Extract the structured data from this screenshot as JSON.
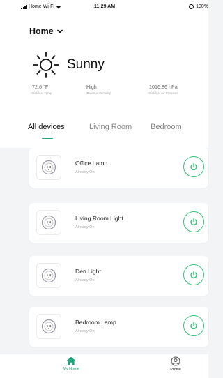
{
  "status_bar": {
    "carrier": "Home Wi-Fi",
    "time": "11:29 AM",
    "battery": "100%"
  },
  "header": {
    "home_label": "Home"
  },
  "weather": {
    "condition": "Sunny",
    "icon": "sun-icon",
    "temperature": {
      "value": "72.6 °F",
      "label": "Outdoor Temp"
    },
    "humidity": {
      "value": "High",
      "label": "Outdoor Humidity"
    },
    "pressure": {
      "value": "1016.86 hPa",
      "label": "Outdoor Air Pressure"
    }
  },
  "tabs": [
    {
      "label": "All devices",
      "active": true
    },
    {
      "label": "Living Room",
      "active": false
    },
    {
      "label": "Bedroom",
      "active": false
    }
  ],
  "devices": [
    {
      "name": "Office Lamp",
      "status": "Already On",
      "icon": "smart-plug-icon"
    },
    {
      "name": "Living Room Light",
      "status": "Already On",
      "icon": "smart-plug-icon"
    },
    {
      "name": "Den Light",
      "status": "Already On",
      "icon": "smart-plug-icon"
    },
    {
      "name": "Bedroom Lamp",
      "status": "Already On",
      "icon": "smart-plug-icon"
    }
  ],
  "bottom_nav": [
    {
      "label": "My Home",
      "icon": "home-icon",
      "active": true
    },
    {
      "label": "Profile",
      "icon": "profile-icon",
      "active": false
    }
  ],
  "colors": {
    "accent": "#1fa37a",
    "power_on": "#36c27a",
    "page_bg": "#f3f4f6",
    "muted_text": "#aaaaaa"
  }
}
